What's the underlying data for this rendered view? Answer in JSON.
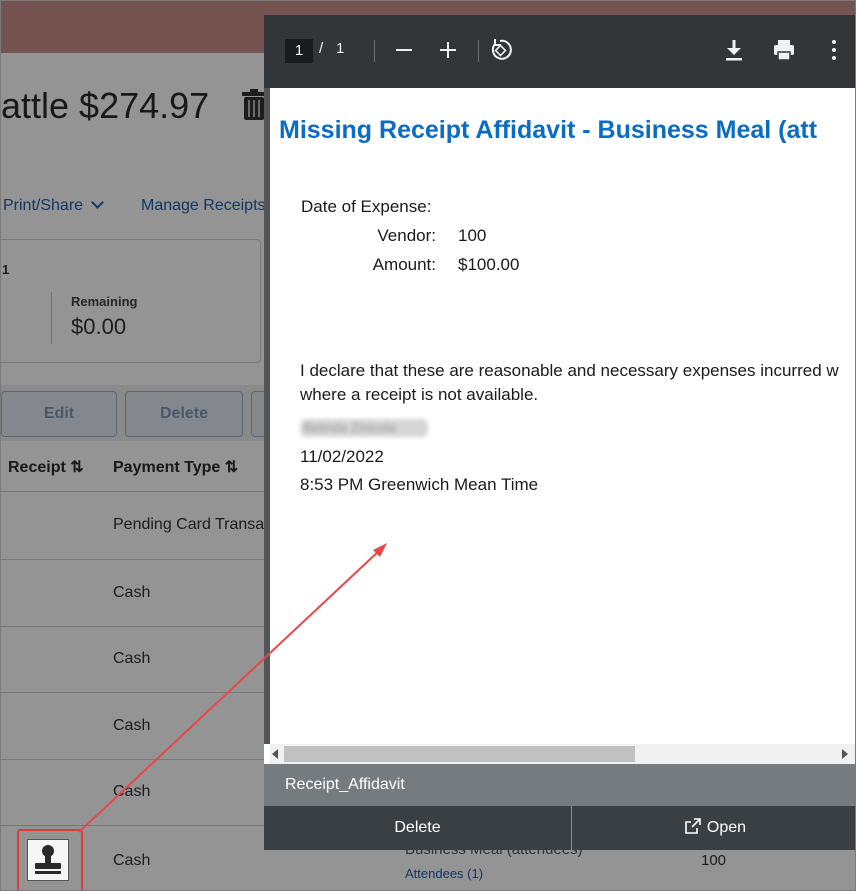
{
  "background": {
    "title": "attle $274.97",
    "links": {
      "print_share": "Print/Share",
      "manage_receipts": "Manage Receipts"
    },
    "summary_card": {
      "count": "1",
      "remaining_label": "Remaining",
      "remaining_value": "$0.00"
    },
    "buttons": {
      "edit": "Edit",
      "delete": "Delete"
    },
    "table": {
      "columns": [
        "Receipt",
        "Payment Type"
      ],
      "payment_types": [
        "Pending Card Transa",
        "Cash",
        "Cash",
        "Cash",
        "Cash",
        "Cash"
      ],
      "last_row": {
        "category": "Business Meal (attendees)",
        "attendees": "Attendees (1)",
        "amount": "100"
      }
    }
  },
  "viewer": {
    "page_current": "1",
    "page_separator": "/",
    "page_total": "1",
    "toolbar_icons": [
      "zoom-out-icon",
      "zoom-in-icon",
      "rotate-icon",
      "download-icon",
      "print-icon",
      "more-icon"
    ],
    "document": {
      "title": "Missing Receipt Affidavit - Business Meal (att",
      "date_label": "Date of Expense:",
      "vendor_label": "Vendor:",
      "vendor_value": "100",
      "amount_label": "Amount:",
      "amount_value": "$100.00",
      "declaration_line1": "I declare that these are reasonable and necessary expenses incurred w",
      "declaration_line2": "where a receipt is not available.",
      "signer_name": "Belinda Zinicola",
      "date": "11/02/2022",
      "time": "8:53 PM Greenwich Mean Time"
    },
    "file_name": "Receipt_Affidavit",
    "actions": {
      "delete": "Delete",
      "open": "Open"
    }
  },
  "colors": {
    "title_blue": "#0b6cc4",
    "toolbar_dark": "#323639",
    "annotation_red": "#e03a3a"
  }
}
